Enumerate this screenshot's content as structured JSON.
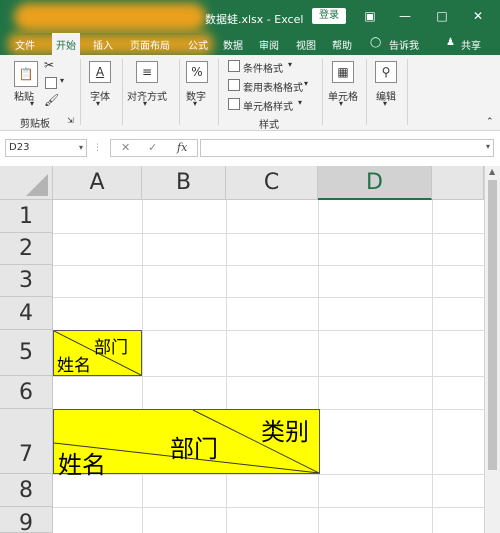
{
  "titlebar": {
    "filename": "数据蛙.xlsx - Excel",
    "login": "登录",
    "accent": "#217346",
    "icons": [
      "ribbon-display-icon",
      "minimize-icon",
      "restore-icon",
      "close-icon"
    ]
  },
  "tabs": [
    "文件",
    "开始",
    "插入",
    "页面布局",
    "公式",
    "数据",
    "审阅",
    "视图",
    "帮助"
  ],
  "tell_me": "告诉我",
  "share": "共享",
  "ribbon": {
    "paste": "粘贴",
    "clipboard": "剪贴板",
    "font": "字体",
    "alignment": "对齐方式",
    "number": "数字",
    "conditional_format": "条件格式",
    "table_format": "套用表格格式",
    "cell_style": "单元格样式",
    "styles": "样式",
    "cells": "单元格",
    "editing": "编辑"
  },
  "formula_bar": {
    "name_box": "D23",
    "fx": "fx",
    "value": ""
  },
  "sheet": {
    "columns": [
      "A",
      "B",
      "C",
      "D"
    ],
    "selected_column": "D",
    "rows": [
      "1",
      "2",
      "3",
      "4",
      "5",
      "6",
      "7",
      "8",
      "9"
    ],
    "a5": {
      "top_right": "部门",
      "bottom_left": "姓名"
    },
    "a7": {
      "top_right": "类别",
      "middle": "部门",
      "bottom_left": "姓名"
    },
    "highlight_color": "#ffff00"
  }
}
